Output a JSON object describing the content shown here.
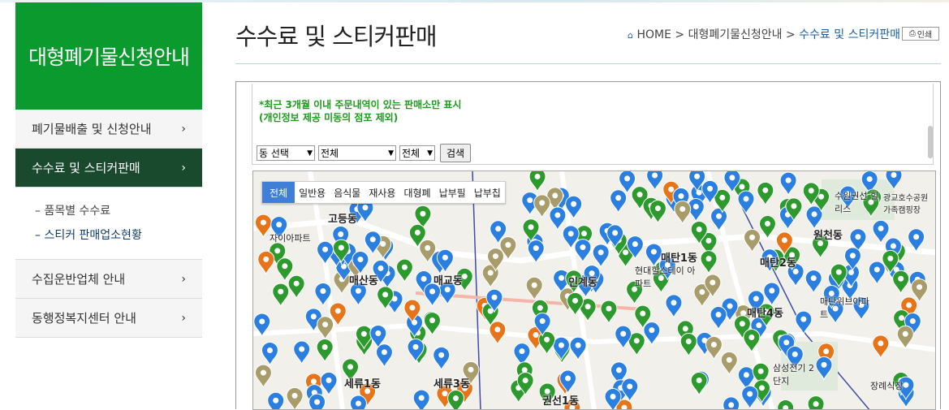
{
  "sidebar": {
    "title": "대형폐기물신청안내",
    "items": [
      {
        "label": "폐기물배출 및 신청안내",
        "chevron": "›"
      },
      {
        "label": "수수료 및 스티커판매",
        "chevron": "›"
      },
      {
        "label": "수집운반업체 안내",
        "chevron": "›"
      },
      {
        "label": "동행정복지센터 안내",
        "chevron": "›"
      }
    ],
    "submenu": [
      {
        "label": "–  품목별 수수료"
      },
      {
        "label": "–  스티커 판매업소현황"
      }
    ]
  },
  "header": {
    "title": "수수료 및 스티커판매",
    "breadcrumb": {
      "home": "HOME",
      "sep": ">",
      "level1": "대형폐기물신청안내",
      "current": "수수료 및 스티커판매"
    },
    "print_label": "인쇄"
  },
  "notice": {
    "line1": "*최근 3개월 이내 주문내역이 있는 판매소만 표시",
    "line2": "(개인정보 제공 미동의 점포 제외)"
  },
  "filters": {
    "dong": "동 선택",
    "type": "전체",
    "type2": "전체",
    "search_label": "검색"
  },
  "map": {
    "tabs": [
      "전체",
      "일반용",
      "음식물",
      "재사용",
      "대형폐",
      "납부필",
      "납부칩"
    ],
    "places": [
      "고등동",
      "매산동",
      "매교동",
      "인계동",
      "매탄1동",
      "매탄2동",
      "매탄4동",
      "원천동",
      "세류1동",
      "세류3동",
      "권선1동",
      "자이아파트",
      "삼성전기 2단지",
      "현대힐스테이 아파트",
      "수원권선 힐리스",
      "광교호수공원 가족캠핑장",
      "매탄위브아파트",
      "장례식장"
    ],
    "colors": {
      "blue": "#2a7fe0",
      "green": "#2d9a2d",
      "orange": "#e8741a",
      "khaki": "#a89d6a"
    }
  }
}
